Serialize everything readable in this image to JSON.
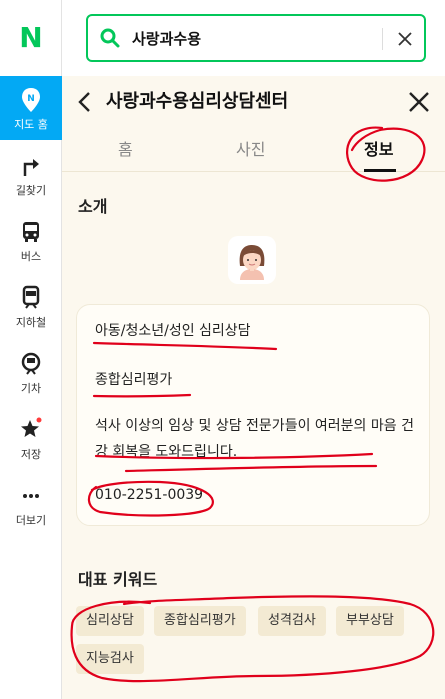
{
  "rail": {
    "logo": "N",
    "items": [
      {
        "label": "지도 홈",
        "icon": "map-pin-icon",
        "active": true
      },
      {
        "label": "길찾기",
        "icon": "directions-icon"
      },
      {
        "label": "버스",
        "icon": "bus-icon"
      },
      {
        "label": "지하철",
        "icon": "subway-icon"
      },
      {
        "label": "기차",
        "icon": "train-icon"
      },
      {
        "label": "저장",
        "icon": "star-icon"
      },
      {
        "label": "더보기",
        "icon": "more-icon"
      }
    ]
  },
  "search": {
    "value": "사랑과수용"
  },
  "place": {
    "title": "사랑과수용심리상담센터",
    "tabs": [
      {
        "label": "홈"
      },
      {
        "label": "사진"
      },
      {
        "label": "정보",
        "active": true
      }
    ]
  },
  "intro": {
    "section_title": "소개",
    "line1": "아동/청소년/성인 심리상담",
    "line2": "종합심리평가",
    "description": "석사 이상의 임상 및 상담 전문가들이 여러분의 마음 건강 회복을 도와드립니다.",
    "phone": "010-2251-0039"
  },
  "keywords": {
    "section_title": "대표 키워드",
    "chips": [
      "심리상담",
      "종합심리평가",
      "성격검사",
      "부부상담",
      "지능검사"
    ]
  },
  "colors": {
    "brand": "#03c75a",
    "active_rail": "#03a9f4",
    "annotation": "#e0001b"
  }
}
